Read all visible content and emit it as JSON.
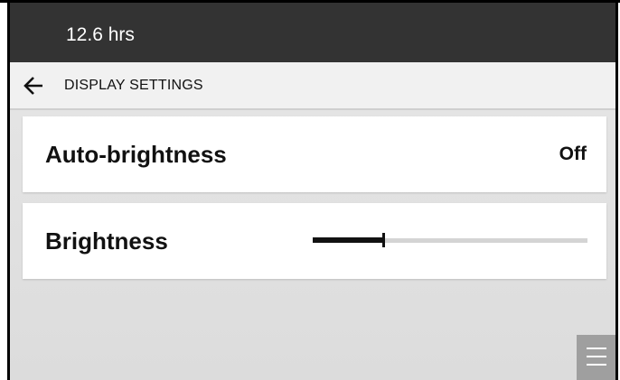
{
  "status_bar": {
    "hours_text": "12.6 hrs"
  },
  "nav": {
    "back_icon": "arrow-left-icon",
    "title": "DISPLAY SETTINGS"
  },
  "settings": {
    "auto_brightness": {
      "label": "Auto-brightness",
      "value": "Off"
    },
    "brightness": {
      "label": "Brightness",
      "level_fraction": 0.26
    }
  },
  "menu_button": {
    "icon": "hamburger-menu-icon"
  },
  "colors": {
    "status_bar_bg": "#333333",
    "nav_bg": "#f1f1f1",
    "content_bg": "#dedede",
    "slider_fill": "#111111",
    "slider_track": "#d4d4d4"
  }
}
